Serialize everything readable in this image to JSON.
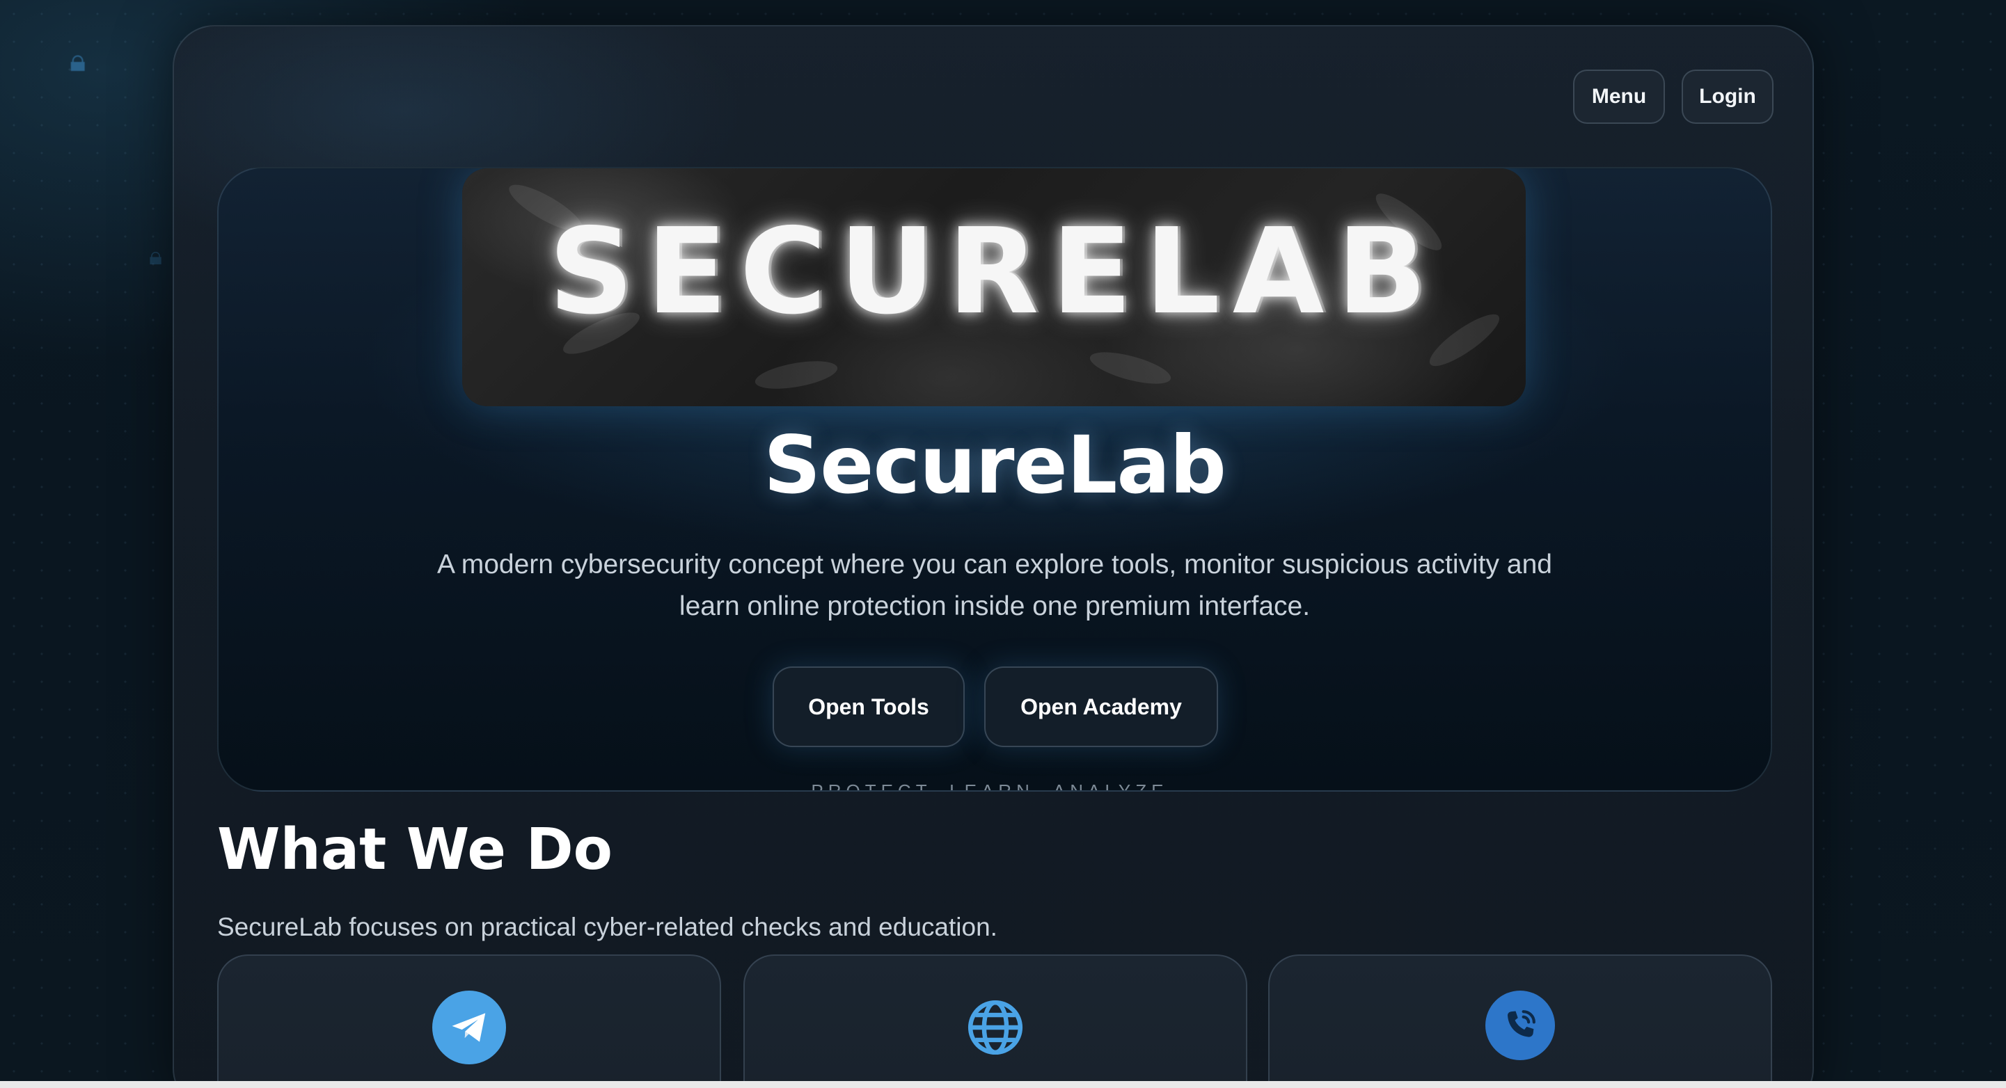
{
  "topbar": {
    "menu_label": "Menu",
    "login_label": "Login"
  },
  "hero": {
    "banner_text": "SECURELAB",
    "title": "SecureLab",
    "description": "A modern cybersecurity concept where you can explore tools, monitor suspicious activity and learn online protection inside one premium interface.",
    "buttons": {
      "tools": "Open Tools",
      "academy": "Open Academy"
    },
    "tagline": "PROTECT. LEARN. ANALYZE."
  },
  "what_we_do": {
    "title": "What We Do",
    "description": "SecureLab focuses on practical cyber-related checks and education.",
    "cards": [
      {
        "icon": "telegram-icon"
      },
      {
        "icon": "globe-icon"
      },
      {
        "icon": "phone-icon"
      }
    ]
  },
  "colors": {
    "accent_blue": "#4aa3e6",
    "phone_blue": "#2d76c9",
    "background": "#0a1620"
  }
}
